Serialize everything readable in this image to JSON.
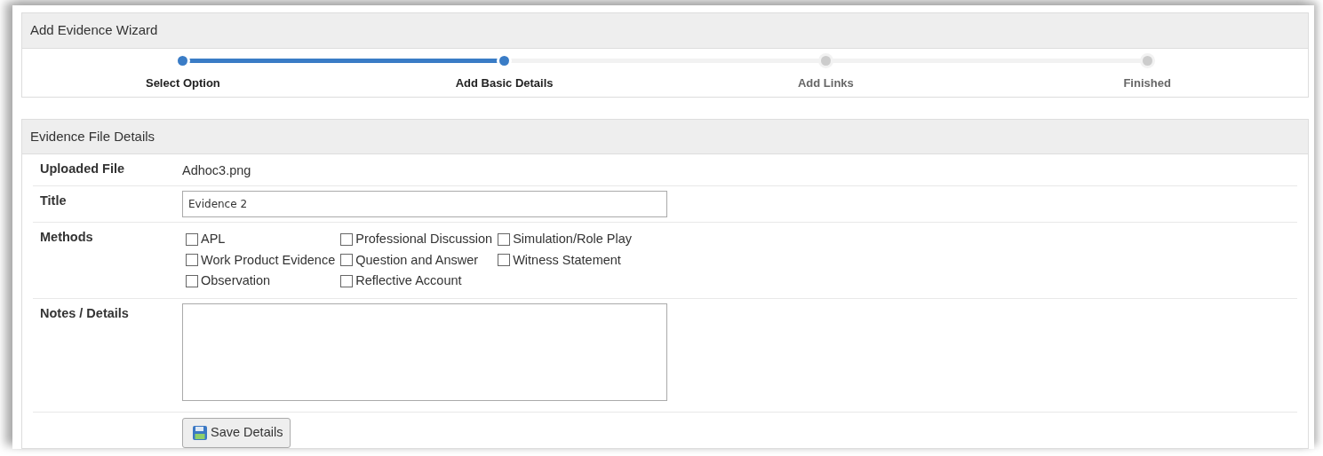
{
  "wizard": {
    "title": "Add Evidence Wizard",
    "steps": [
      {
        "label": "Select Option",
        "done": true
      },
      {
        "label": "Add Basic Details",
        "done": true
      },
      {
        "label": "Add Links",
        "done": false
      },
      {
        "label": "Finished",
        "done": false
      }
    ]
  },
  "details": {
    "title": "Evidence File Details",
    "uploaded_file": {
      "label": "Uploaded File",
      "value": "Adhoc3.png"
    },
    "title_field": {
      "label": "Title",
      "value": "Evidence 2"
    },
    "methods": {
      "label": "Methods",
      "options": [
        {
          "label": "APL",
          "checked": false
        },
        {
          "label": "Professional Discussion",
          "checked": false
        },
        {
          "label": "Simulation/Role Play",
          "checked": false
        },
        {
          "label": "Work Product Evidence",
          "checked": false
        },
        {
          "label": "Question and Answer",
          "checked": false
        },
        {
          "label": "Witness Statement",
          "checked": false
        },
        {
          "label": "Observation",
          "checked": false
        },
        {
          "label": "Reflective Account",
          "checked": false
        }
      ]
    },
    "notes": {
      "label": "Notes / Details"
    },
    "save_button": "Save Details"
  }
}
